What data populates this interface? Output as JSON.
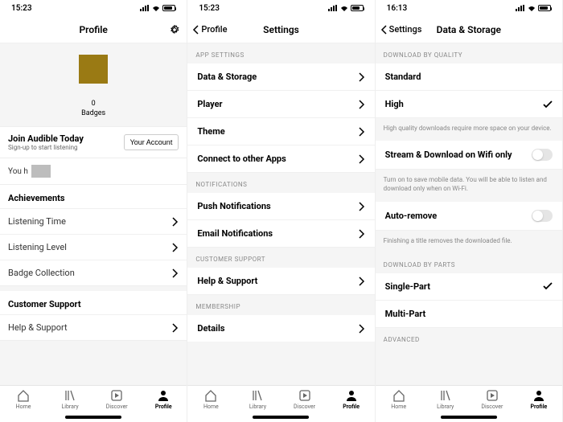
{
  "status_times": [
    "15:23",
    "15:23",
    "16:13"
  ],
  "tabbar": {
    "items": [
      {
        "label": "Home"
      },
      {
        "label": "Library"
      },
      {
        "label": "Discover"
      },
      {
        "label": "Profile"
      }
    ],
    "active_index": 3
  },
  "profile": {
    "title": "Profile",
    "badge_count": "0",
    "badge_label": "Badges",
    "join_title": "Join Audible Today",
    "join_sub": "Sign-up to start listening",
    "your_account": "Your Account",
    "you_h": "You h",
    "achievements_header": "Achievements",
    "rows": [
      "Listening Time",
      "Listening Level",
      "Badge Collection"
    ],
    "support_header": "Customer Support",
    "support_row": "Help & Support"
  },
  "settings": {
    "back": "Profile",
    "title": "Settings",
    "groups": [
      {
        "header": "APP SETTINGS",
        "rows": [
          "Data & Storage",
          "Player",
          "Theme",
          "Connect to other Apps"
        ]
      },
      {
        "header": "NOTIFICATIONS",
        "rows": [
          "Push Notifications",
          "Email Notifications"
        ]
      },
      {
        "header": "CUSTOMER SUPPORT",
        "rows": [
          "Help & Support"
        ]
      },
      {
        "header": "MEMBERSHIP",
        "rows": [
          "Details"
        ]
      }
    ]
  },
  "datastorage": {
    "back": "Settings",
    "title": "Data & Storage",
    "quality_header": "DOWNLOAD BY QUALITY",
    "quality_options": [
      "Standard",
      "High"
    ],
    "quality_selected": "High",
    "quality_hint": "High quality downloads require more space on your device.",
    "wifi_row": "Stream & Download on Wifi only",
    "wifi_hint": "Turn on to save mobile data. You will be able to listen and download only when on Wi-Fi.",
    "autoremove_row": "Auto-remove",
    "autoremove_hint": "Finishing a title removes the downloaded file.",
    "parts_header": "DOWNLOAD BY PARTS",
    "parts_options": [
      "Single-Part",
      "Multi-Part"
    ],
    "parts_selected": "Single-Part",
    "advanced_header": "ADVANCED"
  }
}
